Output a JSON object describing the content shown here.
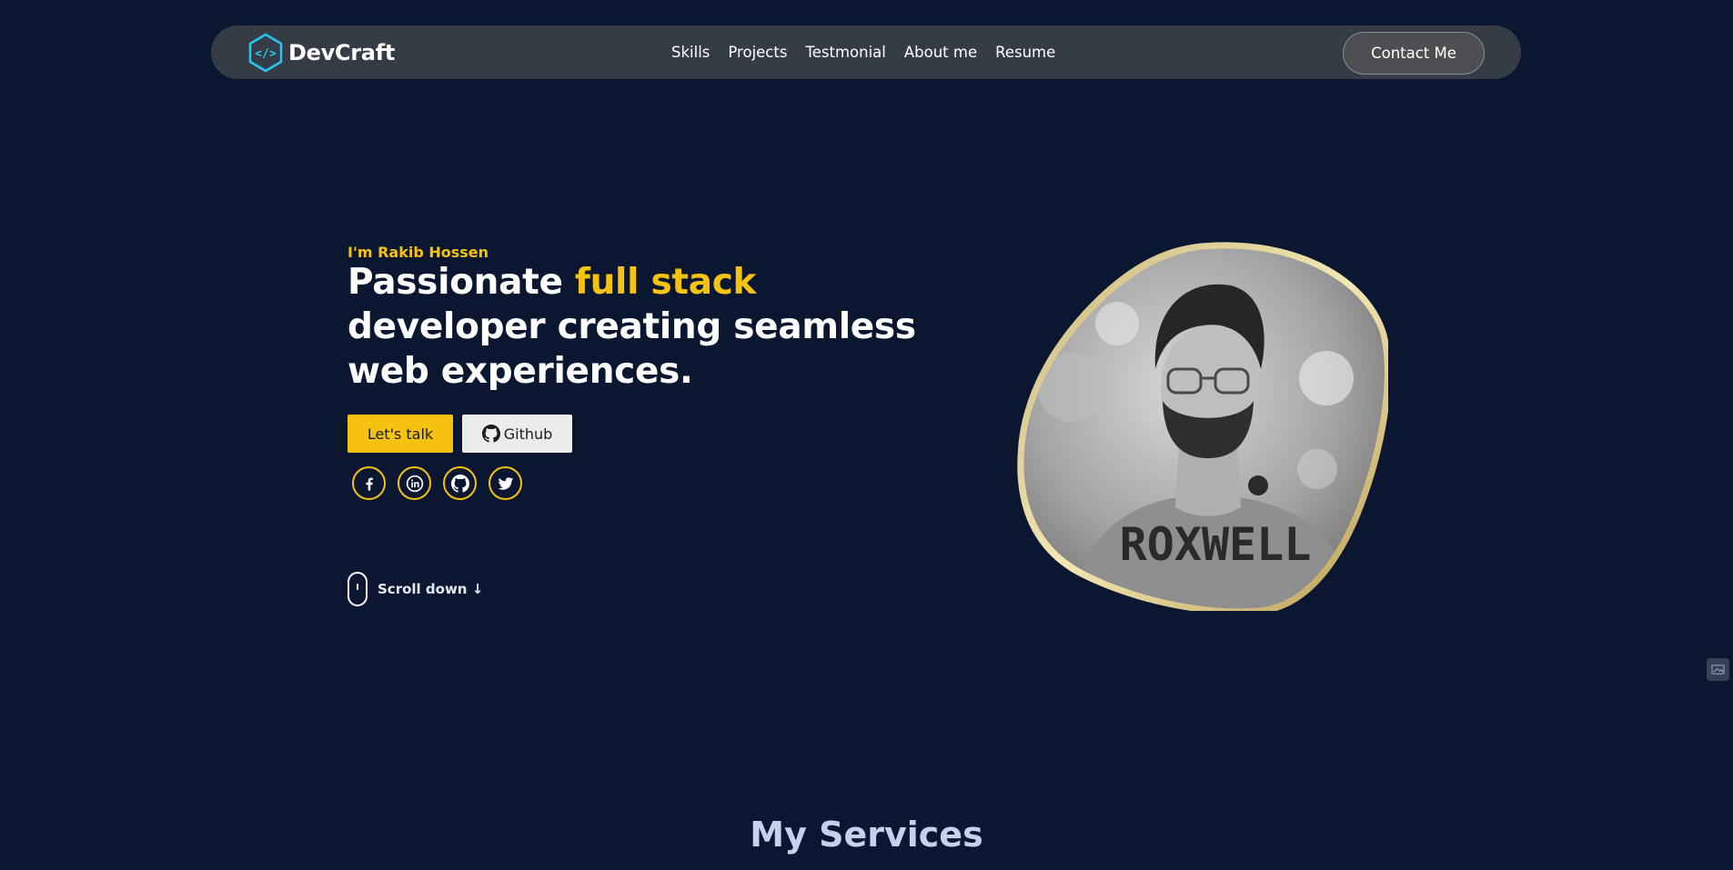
{
  "nav": {
    "brand": "DevCraft",
    "links": [
      "Skills",
      "Projects",
      "Testmonial",
      "About me",
      "Resume"
    ],
    "contact_label": "Contact Me"
  },
  "hero": {
    "intro": "I'm Rakib Hossen",
    "title_part1": "Passionate ",
    "title_accent": "full stack",
    "title_part2": " developer creating seamless web experiences.",
    "talk_label": "Let's talk",
    "github_label": "Github",
    "social_icons": [
      "facebook-icon",
      "linkedin-icon",
      "github-icon",
      "twitter-icon"
    ],
    "scroll_label": "Scroll down ↓",
    "portrait_shirt_text": "ROXWELL"
  },
  "services": {
    "title": "My Services"
  },
  "colors": {
    "background": "#0b1730",
    "nav_background": "#363c45",
    "accent": "#f5c20f",
    "logo_cyan": "#29c6f0",
    "services_title": "#c5d1ef"
  }
}
